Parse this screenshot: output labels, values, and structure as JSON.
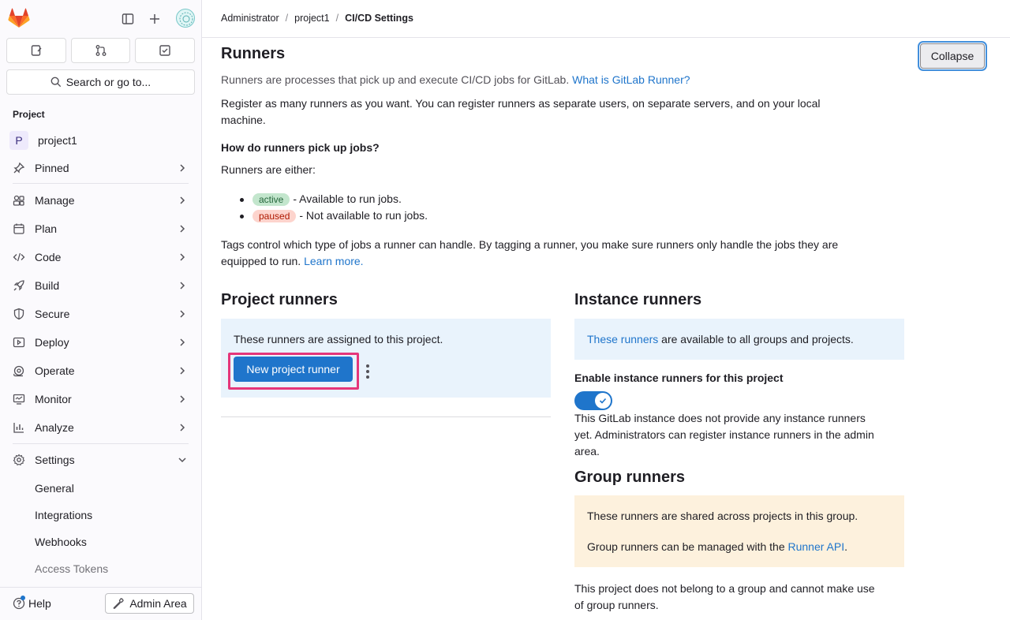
{
  "sidebar": {
    "search_label": "Search or go to...",
    "section_title": "Project",
    "project_name": "project1",
    "project_initial": "P",
    "items": [
      {
        "label": "Pinned"
      },
      {
        "label": "Manage"
      },
      {
        "label": "Plan"
      },
      {
        "label": "Code"
      },
      {
        "label": "Build"
      },
      {
        "label": "Secure"
      },
      {
        "label": "Deploy"
      },
      {
        "label": "Operate"
      },
      {
        "label": "Monitor"
      },
      {
        "label": "Analyze"
      },
      {
        "label": "Settings"
      }
    ],
    "settings_sub": [
      "General",
      "Integrations",
      "Webhooks",
      "Access Tokens"
    ],
    "help_label": "Help",
    "admin_label": "Admin Area"
  },
  "breadcrumb": [
    "Administrator",
    "project1",
    "CI/CD Settings"
  ],
  "runners": {
    "title": "Runners",
    "collapse_label": "Collapse",
    "intro": "Runners are processes that pick up and execute CI/CD jobs for GitLab.",
    "intro_link": "What is GitLab Runner?",
    "register_text_1": "Register as many runners as you want. You can register runners as separate users, on separate servers, and on your local",
    "register_text_2": "machine.",
    "how_title": "How do runners pick up jobs?",
    "either": "Runners are either:",
    "active_badge": "active",
    "active_text": "- Available to run jobs.",
    "paused_badge": "paused",
    "paused_text": "- Not available to run jobs.",
    "tags_text_1": "Tags control which type of jobs a runner can handle. By tagging a runner, you make sure runners only handle the jobs they are",
    "tags_text_2": "equipped to run.",
    "learn_more": "Learn more."
  },
  "project_runners": {
    "title": "Project runners",
    "assigned_text": "These runners are assigned to this project.",
    "new_button": "New project runner"
  },
  "instance_runners": {
    "title": "Instance runners",
    "link": "These runners",
    "available_text": "are available to all groups and projects.",
    "toggle_label": "Enable instance runners for this project",
    "toggle_on": true,
    "note_1": "This GitLab instance does not provide any instance runners",
    "note_2": "yet. Administrators can register instance runners in the admin",
    "note_3": "area."
  },
  "group_runners": {
    "title": "Group runners",
    "shared_text": "These runners are shared across projects in this group.",
    "api_text": "Group runners can be managed with the",
    "api_link": "Runner API",
    "api_period": ".",
    "no_group_1": "This project does not belong to a group and cannot make use",
    "no_group_2": "of group runners."
  }
}
